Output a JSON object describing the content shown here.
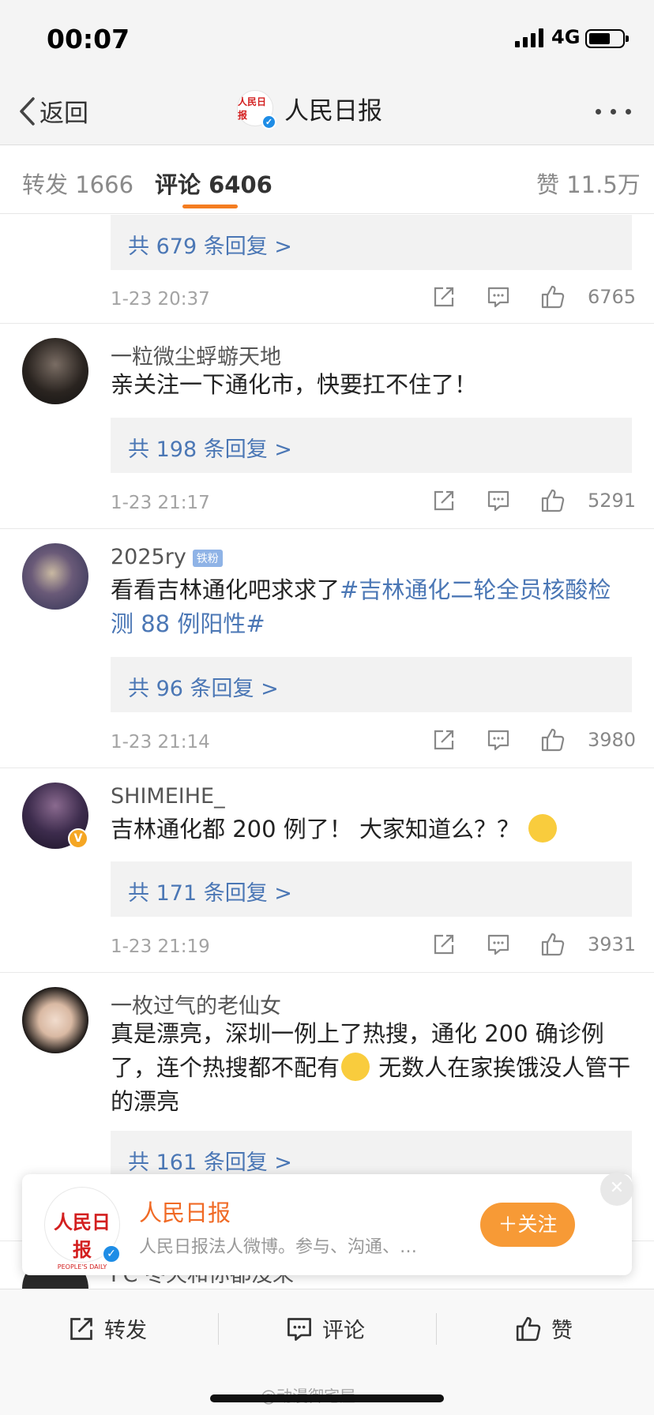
{
  "status": {
    "time": "00:07",
    "network": "4G"
  },
  "nav": {
    "back_label": "返回",
    "title": "人民日报",
    "logo_text": "人民日报"
  },
  "tabs": {
    "repost": "转发 1666",
    "comments": "评论 6406",
    "likes": "赞 11.5万"
  },
  "comments": [
    {
      "reply": "共 679 条回复 >",
      "time": "1-23 20:37",
      "likes": "6765"
    },
    {
      "user": "一粒微尘蜉蝣天地",
      "text": "亲关注一下通化市，快要扛不住了！",
      "reply": "共 198 条回复 >",
      "time": "1-23 21:17",
      "likes": "5291"
    },
    {
      "user": "2025ry",
      "badge": "铁粉",
      "text": "看看吉林通化吧求求了",
      "hashtag": "#吉林通化二轮全员核酸检测 88 例阳性#",
      "reply": "共 96 条回复 >",
      "time": "1-23 21:14",
      "likes": "3980"
    },
    {
      "user": "SHIMEIHE_",
      "text": "吉林通化都 200 例了！ 大家知道么？？",
      "reply": "共 171 条回复 >",
      "time": "1-23 21:19",
      "likes": "3931"
    },
    {
      "user": "一枚过气的老仙女",
      "text_a": "真是漂亮，深圳一例上了热搜，通化 200 确诊例了，连个热搜都不配有",
      "text_b": " 无数人在家挨饿没人管干的漂亮",
      "reply": "共 161 条回复 >"
    },
    {
      "user": "FC 冬天和你都没来"
    }
  ],
  "popup": {
    "name": "人民日报",
    "desc": "人民日报法人微博。参与、沟通、…",
    "logo_cn": "人民日报",
    "logo_en": "PEOPLE'S DAILY",
    "follow": "＋关注"
  },
  "bottom": {
    "repost": "转发",
    "comment": "评论",
    "like": "赞"
  },
  "watermark": "@动漫御宅屋",
  "icons": [
    "back-chevron-icon",
    "more-dots-icon",
    "share-icon",
    "comment-icon",
    "like-icon",
    "verified-icon",
    "close-icon"
  ],
  "colors": {
    "link": "#4b77b5",
    "accent": "#f47d20",
    "follow_button": "#f79a36"
  }
}
